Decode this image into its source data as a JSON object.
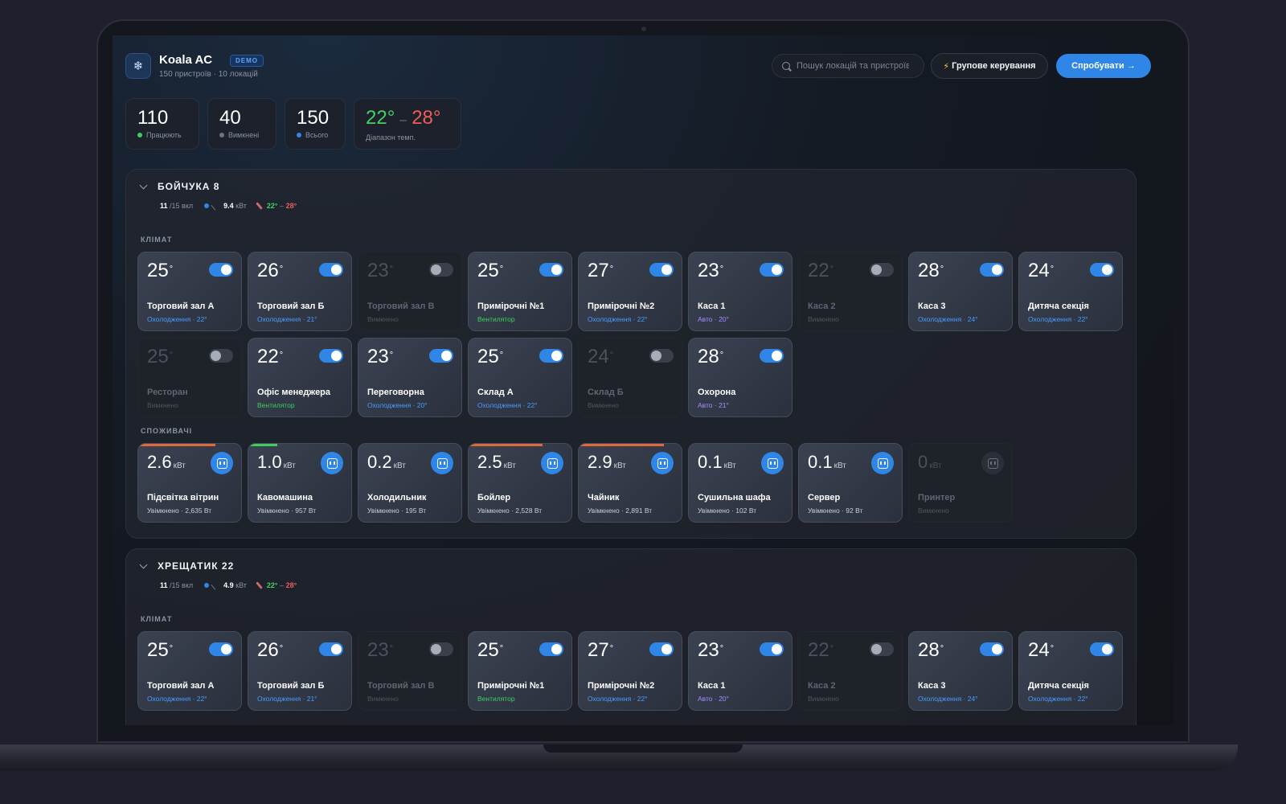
{
  "app": {
    "title": "Koala AC",
    "badge": "DEMO",
    "subtitle": "150 пристроїв · 10 локацій",
    "logo_icon": "snowflake-icon"
  },
  "search": {
    "placeholder": "Пошук локацій та пристроїв"
  },
  "actions": {
    "group_control": "Групове керування",
    "group_icon": "⚡",
    "try": "Спробувати →"
  },
  "stats": [
    {
      "value": "110",
      "label": "Працюють",
      "color": "#3fce5e"
    },
    {
      "value": "40",
      "label": "Вимкнені",
      "color": "#6c7484"
    },
    {
      "value": "150",
      "label": "Всього",
      "color": "#2f86e6"
    }
  ],
  "temp_range": {
    "low": "22°",
    "high": "28°",
    "dash": "–",
    "label": "Діапазон темп."
  },
  "colors": {
    "accent": "#2f86e6",
    "cool": "#4a9bff",
    "fan": "#3fce5e",
    "auto": "#a98cff",
    "low": "#44d163",
    "high": "#ef5c5c"
  },
  "locations": [
    {
      "name": "БОЙЧУКА 8",
      "on": "11",
      "total": "/15 вкл",
      "power": "9.4",
      "power_unit": "кВт",
      "t_low": "22°",
      "t_high": "28°",
      "climate_label": "КЛІМАТ",
      "consumers_label": "СПОЖИВАЧІ",
      "climate": [
        {
          "temp": "25",
          "name": "Торговий зал А",
          "status": "Охолодження · 22°",
          "mode": "cool",
          "on": true
        },
        {
          "temp": "26",
          "name": "Торговий зал Б",
          "status": "Охолодження · 21°",
          "mode": "cool",
          "on": true
        },
        {
          "temp": "23",
          "name": "Торговий зал В",
          "status": "Вимкнено",
          "mode": "off",
          "on": false
        },
        {
          "temp": "25",
          "name": "Примірочні №1",
          "status": "Вентилятор",
          "mode": "fan",
          "on": true
        },
        {
          "temp": "27",
          "name": "Примірочні №2",
          "status": "Охолодження · 22°",
          "mode": "cool",
          "on": true
        },
        {
          "temp": "23",
          "name": "Каса 1",
          "status": "Авто · 20°",
          "mode": "auto",
          "on": true
        },
        {
          "temp": "22",
          "name": "Каса 2",
          "status": "Вимкнено",
          "mode": "off",
          "on": false
        },
        {
          "temp": "28",
          "name": "Каса 3",
          "status": "Охолодження · 24°",
          "mode": "cool",
          "on": true
        },
        {
          "temp": "24",
          "name": "Дитяча секція",
          "status": "Охолодження · 22°",
          "mode": "cool",
          "on": true
        },
        {
          "temp": "25",
          "name": "Ресторан",
          "status": "Вимкнено",
          "mode": "off",
          "on": false
        },
        {
          "temp": "22",
          "name": "Офіс менеджера",
          "status": "Вентилятор",
          "mode": "fan",
          "on": true
        },
        {
          "temp": "23",
          "name": "Переговорна",
          "status": "Охолодження · 20°",
          "mode": "cool",
          "on": true
        },
        {
          "temp": "25",
          "name": "Склад А",
          "status": "Охолодження · 22°",
          "mode": "cool",
          "on": true
        },
        {
          "temp": "24",
          "name": "Склад Б",
          "status": "Вимкнено",
          "mode": "off",
          "on": false
        },
        {
          "temp": "28",
          "name": "Охорона",
          "status": "Авто · 21°",
          "mode": "auto",
          "on": true
        }
      ],
      "consumers": [
        {
          "kw": "2.6",
          "unit": "кВт",
          "name": "Підсвітка вітрин",
          "status": "Увімкнено · 2,635 Вт",
          "on": true,
          "load": 0.75,
          "load_color": "#e0683a"
        },
        {
          "kw": "1.0",
          "unit": "кВт",
          "name": "Кавомашина",
          "status": "Увімкнено · 957 Вт",
          "on": true,
          "load": 0.28,
          "load_color": "#3fce5e"
        },
        {
          "kw": "0.2",
          "unit": "кВт",
          "name": "Холодильник",
          "status": "Увімкнено · 195 Вт",
          "on": true,
          "load": 0,
          "load_color": "#3fce5e"
        },
        {
          "kw": "2.5",
          "unit": "кВт",
          "name": "Бойлер",
          "status": "Увімкнено · 2,528 Вт",
          "on": true,
          "load": 0.72,
          "load_color": "#e0683a"
        },
        {
          "kw": "2.9",
          "unit": "кВт",
          "name": "Чайник",
          "status": "Увімкнено · 2,891 Вт",
          "on": true,
          "load": 0.83,
          "load_color": "#e0683a"
        },
        {
          "kw": "0.1",
          "unit": "кВт",
          "name": "Сушильна шафа",
          "status": "Увімкнено · 102 Вт",
          "on": true,
          "load": 0,
          "load_color": "#3fce5e"
        },
        {
          "kw": "0.1",
          "unit": "кВт",
          "name": "Сервер",
          "status": "Увімкнено · 92 Вт",
          "on": true,
          "load": 0,
          "load_color": "#3fce5e"
        },
        {
          "kw": "0",
          "unit": "кВт",
          "name": "Принтер",
          "status": "Вимкнено",
          "on": false,
          "load": 0,
          "load_color": "#3fce5e"
        }
      ]
    },
    {
      "name": "ХРЕЩАТИК 22",
      "on": "11",
      "total": "/15 вкл",
      "power": "4.9",
      "power_unit": "кВт",
      "t_low": "22°",
      "t_high": "28°",
      "climate_label": "КЛІМАТ",
      "climate": [
        {
          "temp": "25",
          "name": "Торговий зал А",
          "status": "Охолодження · 22°",
          "mode": "cool",
          "on": true
        },
        {
          "temp": "26",
          "name": "Торговий зал Б",
          "status": "Охолодження · 21°",
          "mode": "cool",
          "on": true
        },
        {
          "temp": "23",
          "name": "Торговий зал В",
          "status": "Вимкнено",
          "mode": "off",
          "on": false
        },
        {
          "temp": "25",
          "name": "Примірочні №1",
          "status": "Вентилятор",
          "mode": "fan",
          "on": true
        },
        {
          "temp": "27",
          "name": "Примірочні №2",
          "status": "Охолодження · 22°",
          "mode": "cool",
          "on": true
        },
        {
          "temp": "23",
          "name": "Каса 1",
          "status": "Авто · 20°",
          "mode": "auto",
          "on": true
        },
        {
          "temp": "22",
          "name": "Каса 2",
          "status": "Вимкнено",
          "mode": "off",
          "on": false
        },
        {
          "temp": "28",
          "name": "Каса 3",
          "status": "Охолодження · 24°",
          "mode": "cool",
          "on": true
        },
        {
          "temp": "24",
          "name": "Дитяча секція",
          "status": "Охолодження · 22°",
          "mode": "cool",
          "on": true
        }
      ]
    }
  ]
}
